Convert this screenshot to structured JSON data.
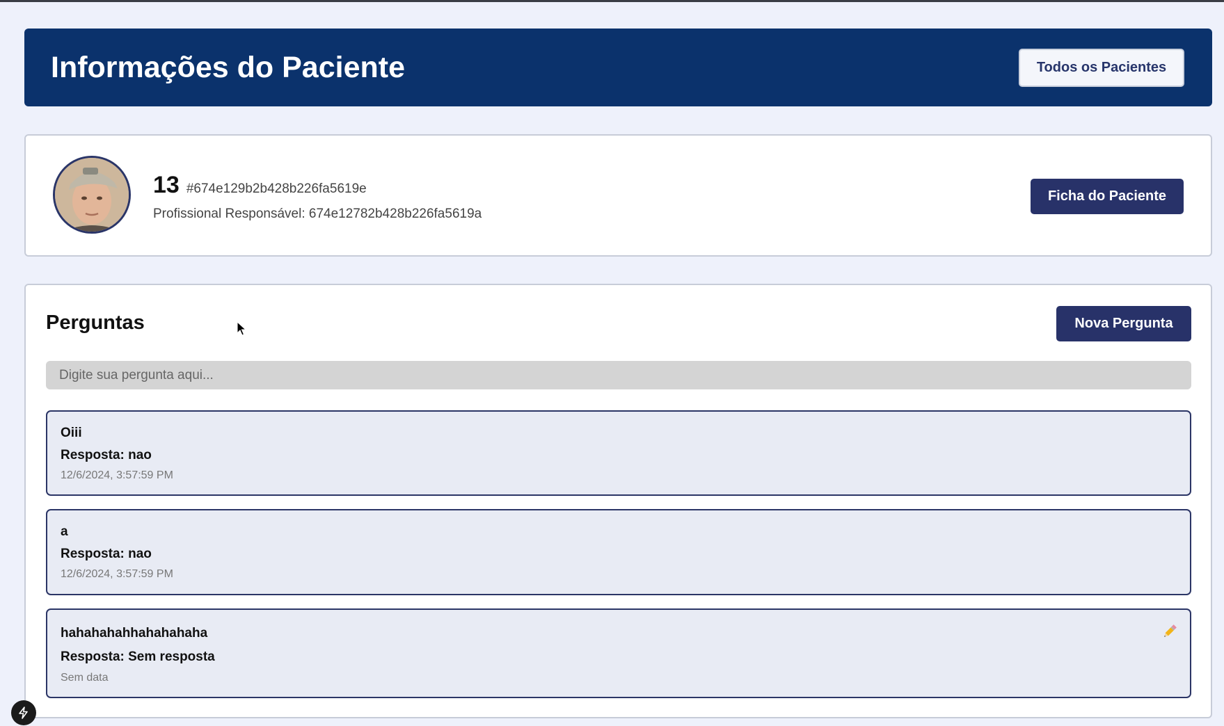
{
  "header": {
    "title": "Informações do Paciente",
    "all_patients_button": "Todos os Pacientes"
  },
  "patient": {
    "name": "13",
    "id": "#674e129b2b428b226fa5619e",
    "professional": "Profissional Responsável: 674e12782b428b226fa5619a",
    "record_button": "Ficha do Paciente"
  },
  "questions": {
    "title": "Perguntas",
    "new_button": "Nova Pergunta",
    "input_placeholder": "Digite sua pergunta aqui...",
    "items": [
      {
        "question": "Oiii",
        "answer": "Resposta: nao",
        "date": "12/6/2024, 3:57:59 PM"
      },
      {
        "question": "a",
        "answer": "Resposta: nao",
        "date": "12/6/2024, 3:57:59 PM"
      },
      {
        "question": "hahahahahhahahahaha",
        "answer": "Resposta: Sem resposta",
        "date": "Sem data",
        "editable": true
      }
    ]
  },
  "colors": {
    "header_bg": "#0b326c",
    "button_dark": "#283269",
    "page_bg": "#eef1fb"
  },
  "icons": {
    "edit": "pencil-icon",
    "dev_tools": "lightning-icon"
  }
}
